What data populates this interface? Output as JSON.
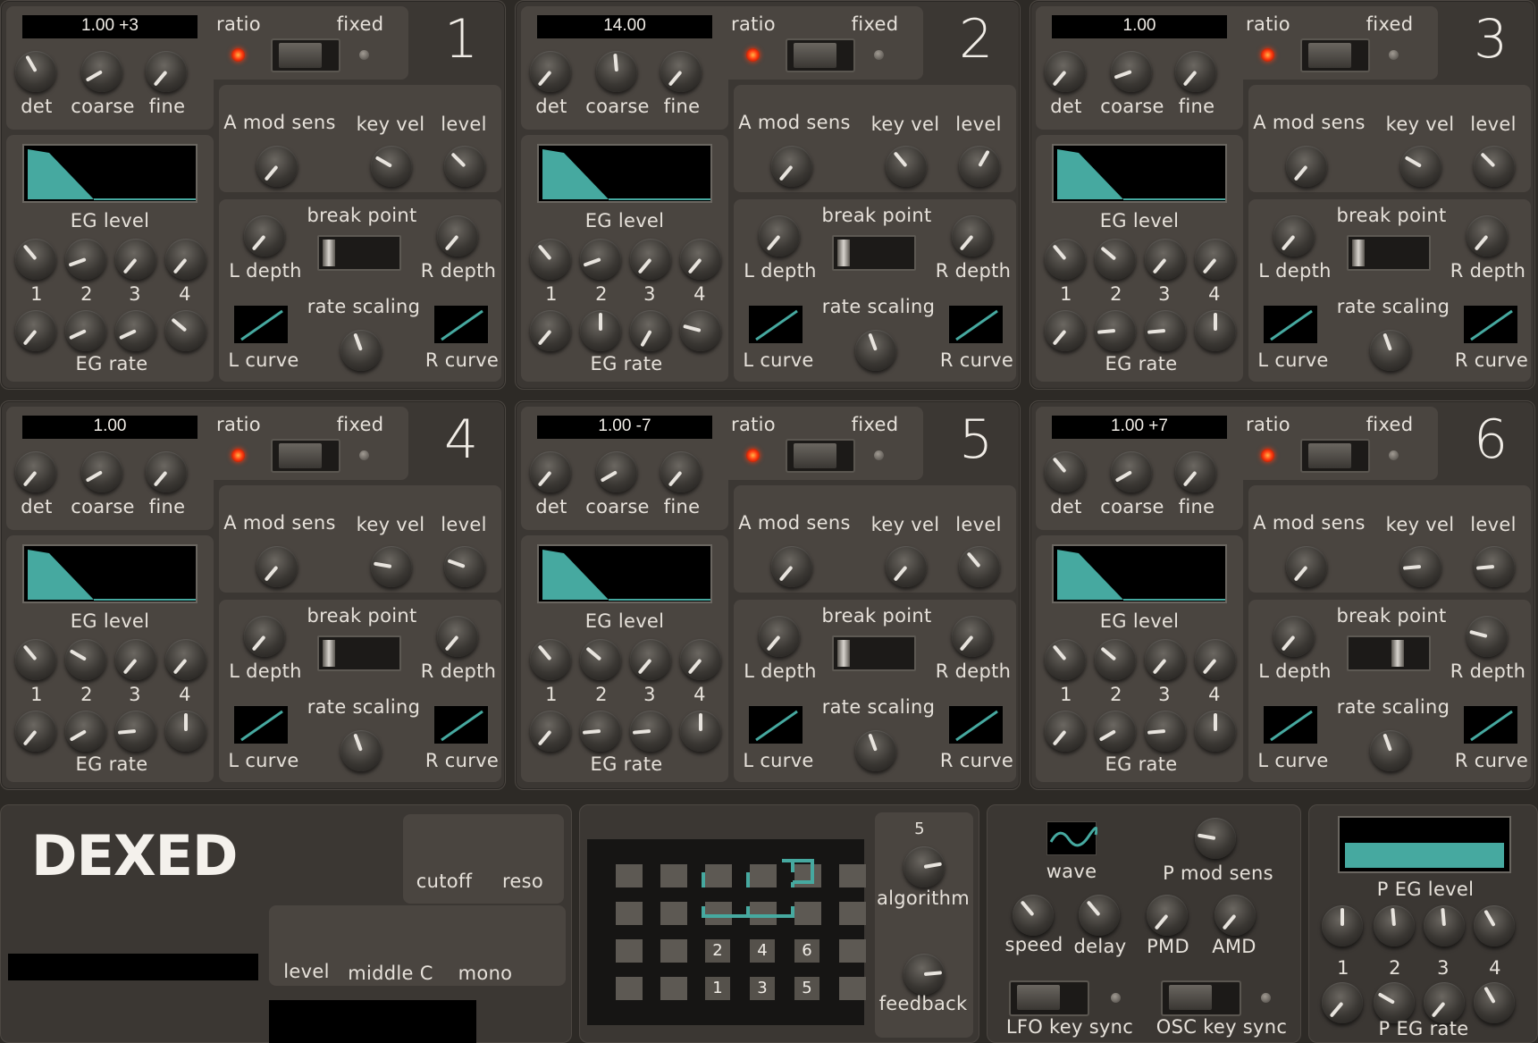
{
  "operators": [
    {
      "number": "1",
      "freq": "1.00 +3"
    },
    {
      "number": "2",
      "freq": "14.00"
    },
    {
      "number": "3",
      "freq": "1.00"
    },
    {
      "number": "4",
      "freq": "1.00"
    },
    {
      "number": "5",
      "freq": "1.00 -7"
    },
    {
      "number": "6",
      "freq": "1.00 +7"
    }
  ],
  "labels": {
    "ratio": "ratio",
    "fixed": "fixed",
    "det": "det",
    "coarse": "coarse",
    "fine": "fine",
    "a_mod_sens": "A mod sens",
    "key_vel": "key vel",
    "level": "level",
    "eg_level": "EG level",
    "eg_rate": "EG rate",
    "break_point": "break point",
    "l_depth": "L depth",
    "r_depth": "R depth",
    "rate_scaling": "rate scaling",
    "l_curve": "L curve",
    "r_curve": "R curve",
    "n1": "1",
    "n2": "2",
    "n3": "3",
    "n4": "4"
  },
  "global": {
    "logo": "DEXED",
    "cutoff": "cutoff",
    "reso": "reso",
    "level": "level",
    "middle_c": "middle C",
    "mono": "mono"
  },
  "algo": {
    "number": "5",
    "algorithm": "algorithm",
    "feedback": "feedback",
    "boxes": [
      "2",
      "4",
      "6",
      "1",
      "3",
      "5"
    ]
  },
  "lfo": {
    "wave": "wave",
    "p_mod_sens": "P mod sens",
    "speed": "speed",
    "delay": "delay",
    "pmd": "PMD",
    "amd": "AMD",
    "lfo_key_sync": "LFO key sync",
    "osc_key_sync": "OSC key sync"
  },
  "peg": {
    "p_eg_level": "P EG level",
    "p_eg_rate": "P EG rate",
    "n1": "1",
    "n2": "2",
    "n3": "3",
    "n4": "4"
  },
  "colors": {
    "accent": "#46a9a0",
    "panel": "#3b3733",
    "led": "#ff3a10"
  }
}
